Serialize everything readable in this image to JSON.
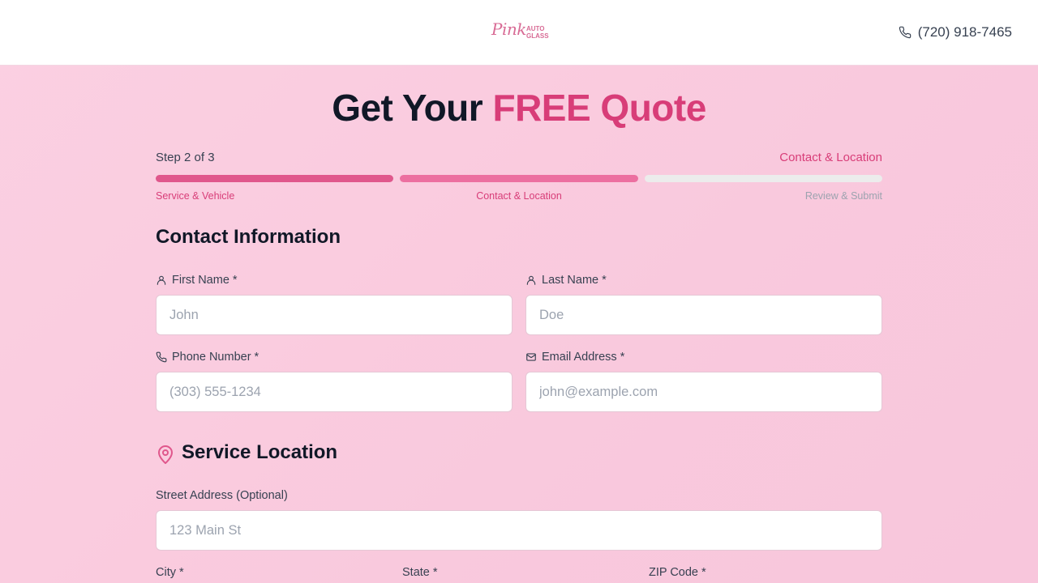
{
  "header": {
    "logo_script": "Pink",
    "logo_line1": "AUTO",
    "logo_line2": "GLASS",
    "phone": "(720) 918-7465"
  },
  "title": {
    "main": "Get Your ",
    "accent": "FREE Quote"
  },
  "progress": {
    "step_text": "Step 2 of 3",
    "current_name": "Contact & Location",
    "steps": [
      {
        "label": "Service & Vehicle",
        "fill": 1.0
      },
      {
        "label": "Contact & Location",
        "fill": 1.0
      },
      {
        "label": "Review & Submit",
        "fill": 0.0
      }
    ]
  },
  "contact": {
    "heading": "Contact Information",
    "first_name": {
      "label": "First Name *",
      "placeholder": "John"
    },
    "last_name": {
      "label": "Last Name *",
      "placeholder": "Doe"
    },
    "phone": {
      "label": "Phone Number *",
      "placeholder": "(303) 555-1234"
    },
    "email": {
      "label": "Email Address *",
      "placeholder": "john@example.com"
    }
  },
  "location": {
    "heading": "Service Location",
    "street": {
      "label": "Street Address (Optional)",
      "placeholder": "123 Main St"
    },
    "city": {
      "label": "City *"
    },
    "state": {
      "label": "State *"
    },
    "zip": {
      "label": "ZIP Code *"
    }
  },
  "colors": {
    "accent": "#d83d78",
    "progress_fill": "#e0578c",
    "background": "#fbd0e2"
  }
}
